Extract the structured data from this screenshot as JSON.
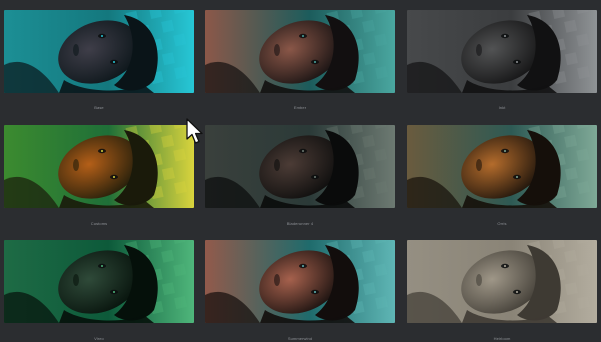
{
  "gallery": {
    "tiles": [
      {
        "label": "Base",
        "name": "tile-base",
        "colors": {
          "bg": "#14787e",
          "accent": "#27c7d6",
          "skin": "#3f3e49",
          "hair": "#0a1418",
          "tint": "#1c8f95"
        }
      },
      {
        "label": "Ember",
        "name": "tile-ember",
        "colors": {
          "bg": "#1c5c5c",
          "accent": "#4aa7a0",
          "skin": "#8a5748",
          "hair": "#120f10",
          "tint": "#8c5849"
        }
      },
      {
        "label": "Inkt",
        "name": "tile-inkt",
        "colors": {
          "bg": "#3b3d3f",
          "accent": "#8f9396",
          "skin": "#525354",
          "hair": "#111112",
          "tint": "#47494b"
        }
      },
      {
        "label": "Customs",
        "name": "tile-customs",
        "colors": {
          "bg": "#1f6f38",
          "accent": "#d9d43d",
          "skin": "#b45f18",
          "hair": "#1a1a0a",
          "tint": "#3c8b2f"
        }
      },
      {
        "label": "Bladerunner 4",
        "name": "tile-bladerunner",
        "colors": {
          "bg": "#2b3a38",
          "accent": "#6d7a72",
          "skin": "#4c3c36",
          "hair": "#0a0b0b",
          "tint": "#3a403c"
        }
      },
      {
        "label": "Orris",
        "name": "tile-orris",
        "colors": {
          "bg": "#2e5a54",
          "accent": "#7fa997",
          "skin": "#b46c2c",
          "hair": "#150f0a",
          "tint": "#6a5b3e"
        }
      },
      {
        "label": "Vireo",
        "name": "tile-vireo",
        "colors": {
          "bg": "#0d5a3a",
          "accent": "#4fb67b",
          "skin": "#2f4a39",
          "hair": "#05100a",
          "tint": "#1e6b45"
        }
      },
      {
        "label": "Summerwind",
        "name": "tile-summerwind",
        "colors": {
          "bg": "#1f6b6c",
          "accent": "#5fb6b5",
          "skin": "#a6614d",
          "hair": "#120d0c",
          "tint": "#925a4b"
        }
      },
      {
        "label": "Heirloom",
        "name": "tile-heirloom",
        "colors": {
          "bg": "#8a8477",
          "accent": "#b3ad9f",
          "skin": "#9f9788",
          "hair": "#3e3a33",
          "tint": "#958f82"
        }
      }
    ]
  }
}
